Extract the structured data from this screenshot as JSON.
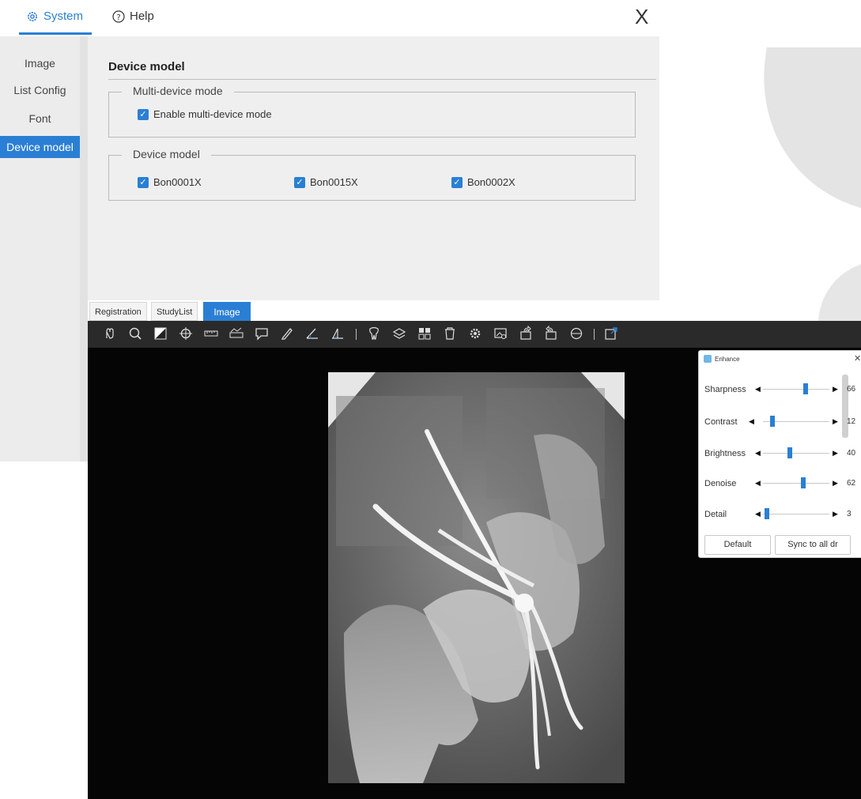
{
  "settings": {
    "tabs": [
      {
        "label": "System",
        "icon": "gear-icon"
      },
      {
        "label": "Help",
        "icon": "help-circle-icon"
      }
    ],
    "close_label": "X",
    "sidebar": [
      "Image",
      "List Config",
      "Font",
      "Device model"
    ],
    "section_title": "Device model",
    "multi_device": {
      "legend": "Multi-device mode",
      "checkbox_label": "Enable multi-device mode"
    },
    "device_model": {
      "legend": "Device model",
      "options": [
        "Bon0001X",
        "Bon0015X",
        "Bon0002X"
      ]
    },
    "accent_color": "#2a7fd4"
  },
  "app": {
    "tabs": [
      "Registration",
      "StudyList",
      "Image"
    ],
    "toolbar_icons": [
      "hand-pointer-icon",
      "zoom-icon",
      "invert-icon",
      "crosshair-icon",
      "ruler-icon",
      "profile-measure-icon",
      "annotation-icon",
      "pencil-icon",
      "angle-icon",
      "cobb-angle-icon",
      "tooth-icon",
      "layers-icon",
      "grid-icon",
      "delete-icon",
      "settings-icon",
      "image-adjust-icon",
      "rotate-left-icon",
      "rotate-right-icon",
      "reset-icon",
      "export-icon"
    ]
  },
  "enhance": {
    "title": "Enhance",
    "close_label": "✕",
    "sliders": [
      {
        "label": "Sharpness",
        "value": 66
      },
      {
        "label": "Contrast",
        "value": 12
      },
      {
        "label": "Brightness",
        "value": 40
      },
      {
        "label": "Denoise",
        "value": 62
      },
      {
        "label": "Detail",
        "value": 3
      }
    ],
    "buttons": {
      "default": "Default",
      "sync": "Sync to all dr"
    }
  }
}
